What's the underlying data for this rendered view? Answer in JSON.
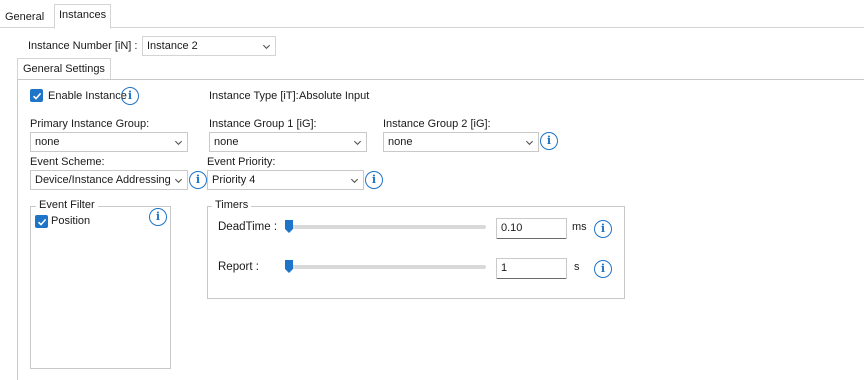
{
  "tabs": [
    {
      "label": "General",
      "active": false
    },
    {
      "label": "Instances",
      "active": true
    }
  ],
  "instance": {
    "number_label": "Instance Number [iN] :",
    "number_value": "Instance 2"
  },
  "subtabs": [
    {
      "label": "General Settings",
      "active": true
    }
  ],
  "settings": {
    "enable_label": "Enable Instance",
    "enable_checked": true,
    "type_label": "Instance Type [iT]:",
    "type_value": "Absolute Input",
    "primary_group_label": "Primary Instance Group:",
    "primary_group_value": "none",
    "group1_label": "Instance Group 1 [iG]:",
    "group1_value": "none",
    "group2_label": "Instance Group 2 [iG]:",
    "group2_value": "none",
    "scheme_label": "Event Scheme:",
    "scheme_value": "Device/Instance Addressing",
    "priority_label": "Event Priority:",
    "priority_value": "Priority 4"
  },
  "event_filter": {
    "title": "Event Filter",
    "items": [
      {
        "label": "Position",
        "checked": true
      }
    ]
  },
  "timers": {
    "title": "Timers",
    "rows": [
      {
        "label": "DeadTime :",
        "value": "0.10",
        "unit": "ms",
        "slider_fraction": 0.0
      },
      {
        "label": "Report :",
        "value": "1",
        "unit": "s",
        "slider_fraction": 0.0
      }
    ]
  },
  "colors": {
    "accent": "#1e74c6",
    "border": "#c8c8c8"
  },
  "icons": {
    "info": "info-icon",
    "chevron": "chevron-down-icon",
    "check": "checkmark-icon"
  }
}
